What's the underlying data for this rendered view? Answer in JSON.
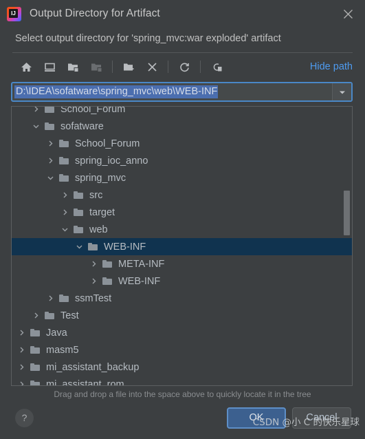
{
  "window": {
    "title": "Output Directory for Artifact",
    "app_icon": "intellij-idea-icon",
    "close_icon": "close-icon"
  },
  "subtitle": "Select output directory for 'spring_mvc:war exploded' artifact",
  "toolbar": {
    "buttons": [
      {
        "name": "home-icon",
        "tooltip": "Home",
        "disabled": false
      },
      {
        "name": "desktop-icon",
        "tooltip": "Desktop",
        "disabled": false
      },
      {
        "name": "expand-folder-icon",
        "tooltip": "Expand",
        "disabled": false
      },
      {
        "name": "collapse-folder-icon",
        "tooltip": "Collapse",
        "disabled": true
      },
      {
        "name": "new-folder-icon",
        "tooltip": "New Folder",
        "disabled": false
      },
      {
        "name": "delete-icon",
        "tooltip": "Delete",
        "disabled": false
      },
      {
        "name": "refresh-icon",
        "tooltip": "Refresh",
        "disabled": false
      },
      {
        "name": "show-hidden-icon",
        "tooltip": "Show Hidden Files",
        "disabled": false
      }
    ],
    "hide_path_label": "Hide path"
  },
  "path_field": {
    "value": "D:\\IDEA\\sofatware\\spring_mvc\\web\\WEB-INF",
    "selected": true,
    "dropdown_icon": "chevron-down-icon"
  },
  "tree": {
    "rows": [
      {
        "label": "School_Forum",
        "indent": 2,
        "state": "collapsed",
        "selected": false,
        "clipped": true
      },
      {
        "label": "sofatware",
        "indent": 2,
        "state": "expanded",
        "selected": false
      },
      {
        "label": "School_Forum",
        "indent": 3,
        "state": "collapsed",
        "selected": false
      },
      {
        "label": "spring_ioc_anno",
        "indent": 3,
        "state": "collapsed",
        "selected": false
      },
      {
        "label": "spring_mvc",
        "indent": 3,
        "state": "expanded",
        "selected": false
      },
      {
        "label": "src",
        "indent": 4,
        "state": "collapsed",
        "selected": false
      },
      {
        "label": "target",
        "indent": 4,
        "state": "collapsed",
        "selected": false
      },
      {
        "label": "web",
        "indent": 4,
        "state": "expanded",
        "selected": false
      },
      {
        "label": "WEB-INF",
        "indent": 5,
        "state": "expanded",
        "selected": true
      },
      {
        "label": "META-INF",
        "indent": 6,
        "state": "collapsed",
        "selected": false
      },
      {
        "label": "WEB-INF",
        "indent": 6,
        "state": "collapsed",
        "selected": false
      },
      {
        "label": "ssmTest",
        "indent": 3,
        "state": "collapsed",
        "selected": false
      },
      {
        "label": "Test",
        "indent": 2,
        "state": "collapsed",
        "selected": false
      },
      {
        "label": "Java",
        "indent": 1,
        "state": "collapsed",
        "selected": false
      },
      {
        "label": "masm5",
        "indent": 1,
        "state": "collapsed",
        "selected": false
      },
      {
        "label": "mi_assistant_backup",
        "indent": 1,
        "state": "collapsed",
        "selected": false
      },
      {
        "label": "mi_assistant_rom",
        "indent": 1,
        "state": "collapsed",
        "selected": false
      }
    ]
  },
  "hint": "Drag and drop a file into the space above to quickly locate it in the tree",
  "footer": {
    "help_label": "?",
    "ok_label": "OK",
    "cancel_label": "Cancel"
  },
  "watermark": "CSDN @小 C 的快乐星球",
  "colors": {
    "dialog_bg": "#3c3f41",
    "selection_row": "#10334f",
    "text_selection": "#4b6eaf",
    "link": "#4e9bf0",
    "primary_button": "#3c608f",
    "focus_border": "#4a88c7"
  }
}
